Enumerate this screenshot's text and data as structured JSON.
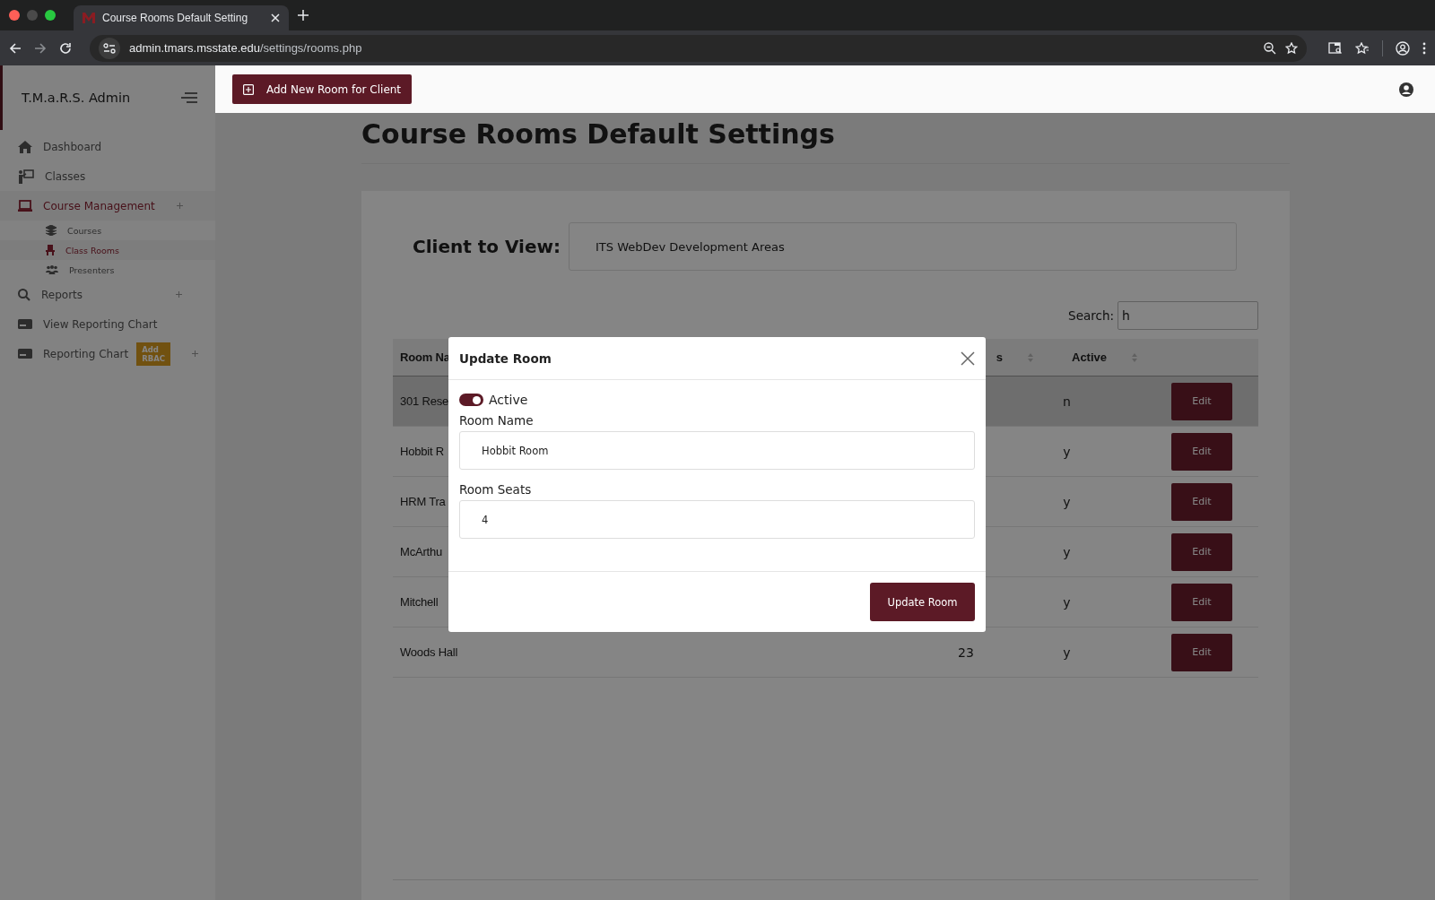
{
  "browser": {
    "tabs": [
      {
        "title": "Course Rooms Default Setting",
        "selected": true
      }
    ],
    "url_host": "admin.tmars.msstate.edu",
    "url_path": "/settings/rooms.php"
  },
  "sidebar": {
    "brand": "T.M.a.R.S. Admin",
    "items": [
      {
        "label": "Dashboard",
        "expandable": false,
        "selected": false
      },
      {
        "label": "Classes",
        "expandable": false,
        "selected": false
      },
      {
        "label": "Course Management",
        "expandable": true,
        "selected": true,
        "children": [
          {
            "label": "Courses",
            "selected": false
          },
          {
            "label": "Class Rooms",
            "selected": true
          },
          {
            "label": "Presenters",
            "selected": false
          }
        ]
      },
      {
        "label": "Reports",
        "expandable": true,
        "selected": false
      },
      {
        "label": "View Reporting Chart",
        "expandable": false,
        "selected": false
      },
      {
        "label": "Reporting Chart",
        "expandable": true,
        "selected": false,
        "badge": "Add RBAC"
      }
    ]
  },
  "topbar": {
    "add_button": "Add New Room for Client"
  },
  "page": {
    "title": "Course Rooms Default Settings",
    "client_label": "Client to View:",
    "client_value": "ITS WebDev Development Areas",
    "search_label": "Search:",
    "search_value": "h",
    "table": {
      "columns": [
        {
          "label": "Room Na"
        },
        {
          "label": "s",
          "sortable": true
        },
        {
          "label": "Active",
          "sortable": true
        }
      ],
      "rows": [
        {
          "name": "301 Rese",
          "active": "n",
          "action": "Edit",
          "selected": true
        },
        {
          "name": "Hobbit R",
          "active": "y",
          "action": "Edit",
          "selected": false
        },
        {
          "name": "HRM Tra",
          "active": "y",
          "action": "Edit",
          "selected": false
        },
        {
          "name": "McArthu",
          "active": "y",
          "action": "Edit",
          "selected": false
        },
        {
          "name": "Mitchell",
          "active": "y",
          "action": "Edit",
          "selected": false
        },
        {
          "name": "Woods Hall",
          "seats": "23",
          "active": "y",
          "action": "Edit",
          "selected": false
        }
      ]
    }
  },
  "modal": {
    "title": "Update Room",
    "active": {
      "label": "Active",
      "checked": true
    },
    "fields": [
      {
        "label": "Room Name",
        "value": "Hobbit Room"
      },
      {
        "label": "Room Seats",
        "value": "4"
      }
    ],
    "submit": "Update Room"
  }
}
